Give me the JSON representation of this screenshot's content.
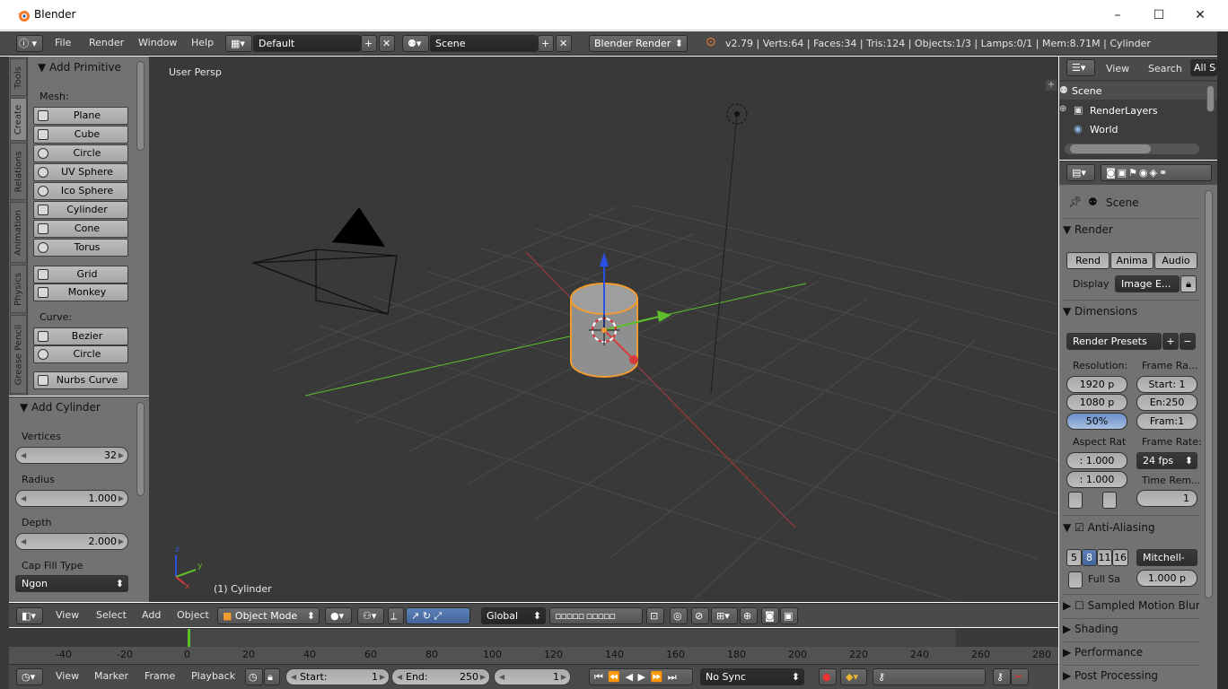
{
  "window": {
    "title": "Blender",
    "controls": {
      "minimize": "–",
      "maximize": "☐",
      "close": "✕"
    }
  },
  "info_header": {
    "menus": [
      "File",
      "Render",
      "Window",
      "Help"
    ],
    "layout": "Default",
    "scene": "Scene",
    "engine": "Blender Render",
    "stats": "v2.79 | Verts:64 | Faces:34 | Tris:124 | Objects:1/3 | Lamps:0/1 | Mem:8.71M | Cylinder"
  },
  "tool_tabs": [
    "Tools",
    "Create",
    "Relations",
    "Animation",
    "Physics",
    "Grease Pencil"
  ],
  "tool_shelf": {
    "panel_title": "▼ Add Primitive",
    "mesh_label": "Mesh:",
    "mesh_items": [
      "Plane",
      "Cube",
      "Circle",
      "UV Sphere",
      "Ico Sphere",
      "Cylinder",
      "Cone",
      "Torus"
    ],
    "mesh_extra": [
      "Grid",
      "Monkey"
    ],
    "curve_label": "Curve:",
    "curve_items": [
      "Bezier",
      "Circle"
    ],
    "curve_extra": [
      "Nurbs Curve"
    ]
  },
  "operator_panel": {
    "title": "▼ Add Cylinder",
    "vertices_label": "Vertices",
    "vertices_value": "32",
    "radius_label": "Radius",
    "radius_value": "1.000",
    "depth_label": "Depth",
    "depth_value": "2.000",
    "cap_label": "Cap Fill Type",
    "cap_value": "Ngon"
  },
  "viewport": {
    "view_name": "User Persp",
    "object_name": "(1) Cylinder",
    "axis_x": "x",
    "axis_y": "y",
    "axis_z": "z"
  },
  "view3d_header": {
    "menus": [
      "View",
      "Select",
      "Add",
      "Object"
    ],
    "mode": "Object Mode",
    "orientation": "Global"
  },
  "timeline": {
    "ruler": [
      "-40",
      "-20",
      "0",
      "20",
      "40",
      "60",
      "80",
      "100",
      "120",
      "140",
      "160",
      "180",
      "200",
      "220",
      "240",
      "260",
      "280"
    ],
    "menus": [
      "View",
      "Marker",
      "Frame",
      "Playback"
    ],
    "start_label": "Start:",
    "start_value": "1",
    "end_label": "End:",
    "end_value": "250",
    "current_frame": "1",
    "sync": "No Sync"
  },
  "outliner": {
    "menus": [
      "View",
      "Search"
    ],
    "filter": "All Sc",
    "items": [
      "Scene",
      "RenderLayers",
      "World"
    ]
  },
  "properties": {
    "context": "Scene",
    "render_panel": "▼ Render",
    "render_buttons": [
      "Rend",
      "Anima",
      "Audio"
    ],
    "display_label": "Display",
    "display_value": "Image E...",
    "dimensions_panel": "▼ Dimensions",
    "render_presets": "Render Presets",
    "resolution_label": "Resolution:",
    "frame_range_label": "Frame Ra...",
    "res_x": "1920 p",
    "res_y": "1080 p",
    "res_pct": "50%",
    "frame_start": "Start: 1",
    "frame_end": "En:250",
    "frame_step": "Fram:1",
    "aspect_label": "Aspect Rat",
    "frame_rate_label": "Frame Rate:",
    "aspect_x": ": 1.000",
    "aspect_y": ": 1.000",
    "fps": "24 fps",
    "time_remap_label": "Time Rem...",
    "time_remap_value": "1",
    "aa_panel": "Anti-Aliasing",
    "aa_samples": [
      "5",
      "8",
      "11",
      "16"
    ],
    "aa_filter": "Mitchell-",
    "full_sample": "Full Sa",
    "filter_size": "1.000 p",
    "sampled_motion": "Sampled Motion Blur",
    "shading": "▶ Shading",
    "performance": "▶ Performance",
    "post_processing": "▶ Post Processing"
  },
  "colors": {
    "blender_grey": "#727272",
    "viewport_bg": "#393939",
    "header_bg": "#4a4a4a",
    "selection_orange": "#f29b2f",
    "x_axis": "#d63b3b",
    "y_axis": "#5dbf2a",
    "z_axis": "#2b4fe0"
  }
}
